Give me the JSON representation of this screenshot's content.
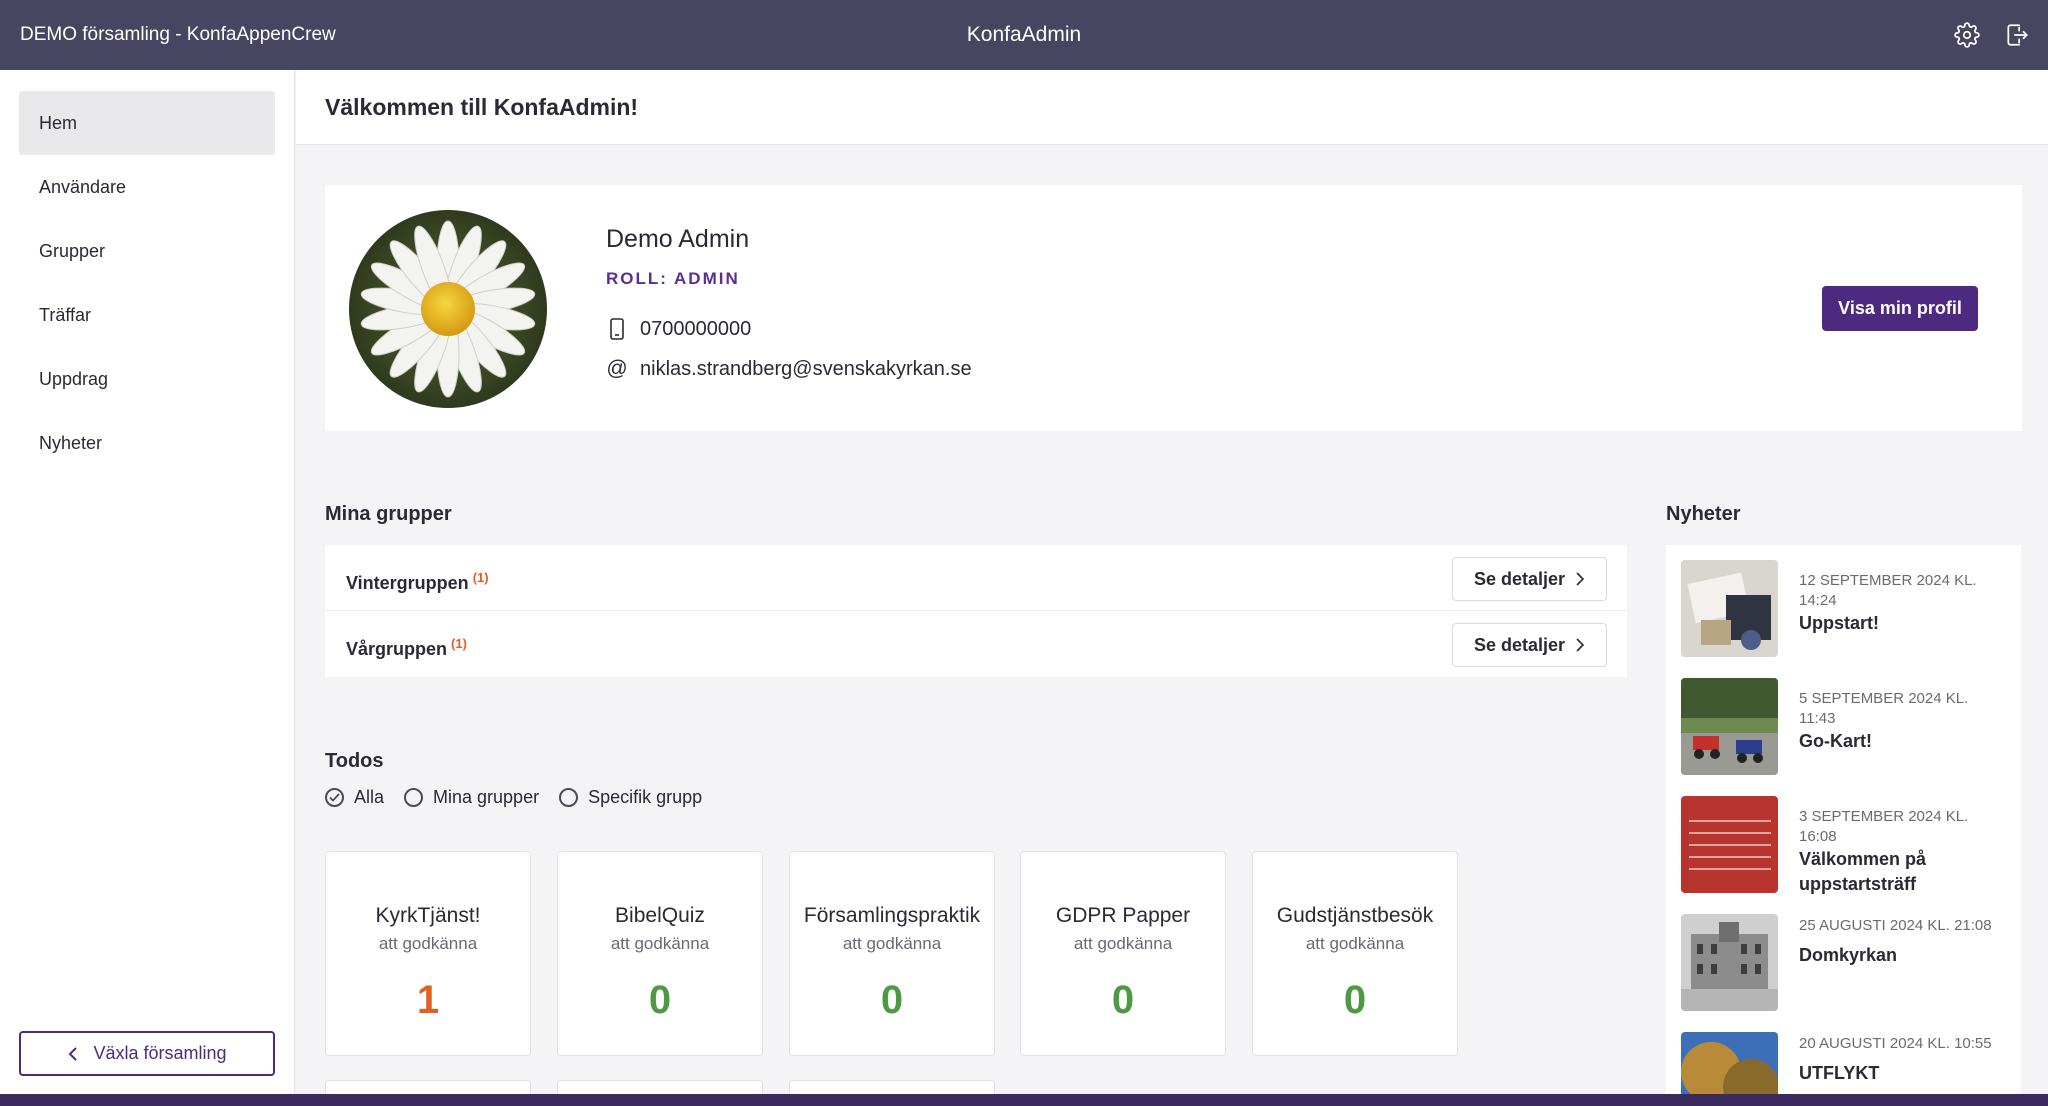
{
  "topbar": {
    "org": "DEMO församling - KonfaAppenCrew",
    "title": "KonfaAdmin",
    "icons": [
      "gear-icon",
      "logout-icon"
    ]
  },
  "sidebar": {
    "items": [
      {
        "label": "Hem",
        "active": true
      },
      {
        "label": "Användare",
        "active": false
      },
      {
        "label": "Grupper",
        "active": false
      },
      {
        "label": "Träffar",
        "active": false
      },
      {
        "label": "Uppdrag",
        "active": false
      },
      {
        "label": "Nyheter",
        "active": false
      }
    ],
    "switch_label": "Växla församling"
  },
  "header": {
    "title": "Välkommen till KonfaAdmin!"
  },
  "profile": {
    "name": "Demo Admin",
    "role": "ROLL: ADMIN",
    "phone": "0700000000",
    "email": "niklas.strandberg@svenskakyrkan.se",
    "button": "Visa min profil"
  },
  "groups": {
    "title": "Mina grupper",
    "details_label": "Se detaljer",
    "rows": [
      {
        "name": "Vintergruppen",
        "count": "(1)"
      },
      {
        "name": "Vårgruppen",
        "count": "(1)"
      }
    ]
  },
  "todos": {
    "title": "Todos",
    "filters": [
      {
        "label": "Alla",
        "checked": true
      },
      {
        "label": "Mina grupper",
        "checked": false
      },
      {
        "label": "Specifik grupp",
        "checked": false
      }
    ],
    "cards": [
      {
        "title": "KyrkTjänst!",
        "sub": "att godkänna",
        "count": "1",
        "pending": true
      },
      {
        "title": "BibelQuiz",
        "sub": "att godkänna",
        "count": "0",
        "pending": false
      },
      {
        "title": "Församlingspraktik",
        "sub": "att godkänna",
        "count": "0",
        "pending": false
      },
      {
        "title": "GDPR Papper",
        "sub": "att godkänna",
        "count": "0",
        "pending": false
      },
      {
        "title": "Gudstjänstbesök",
        "sub": "att godkänna",
        "count": "0",
        "pending": false
      }
    ]
  },
  "news": {
    "title": "Nyheter",
    "items": [
      {
        "date": "12 SEPTEMBER 2024 KL. 14:24",
        "title": "Uppstart!"
      },
      {
        "date": "5 SEPTEMBER 2024 KL. 11:43",
        "title": "Go-Kart!"
      },
      {
        "date": "3 SEPTEMBER 2024 KL. 16:08",
        "title": "Välkommen på uppstartsträff"
      },
      {
        "date": "25 AUGUSTI 2024 KL. 21:08",
        "title": "Domkyrkan"
      },
      {
        "date": "20 AUGUSTI 2024 KL. 10:55",
        "title": "UTFLYKT"
      }
    ]
  },
  "colors": {
    "topbar": "#474660",
    "accent": "#4d2a7f",
    "pending": "#e0601f",
    "done": "#4e9a44"
  }
}
